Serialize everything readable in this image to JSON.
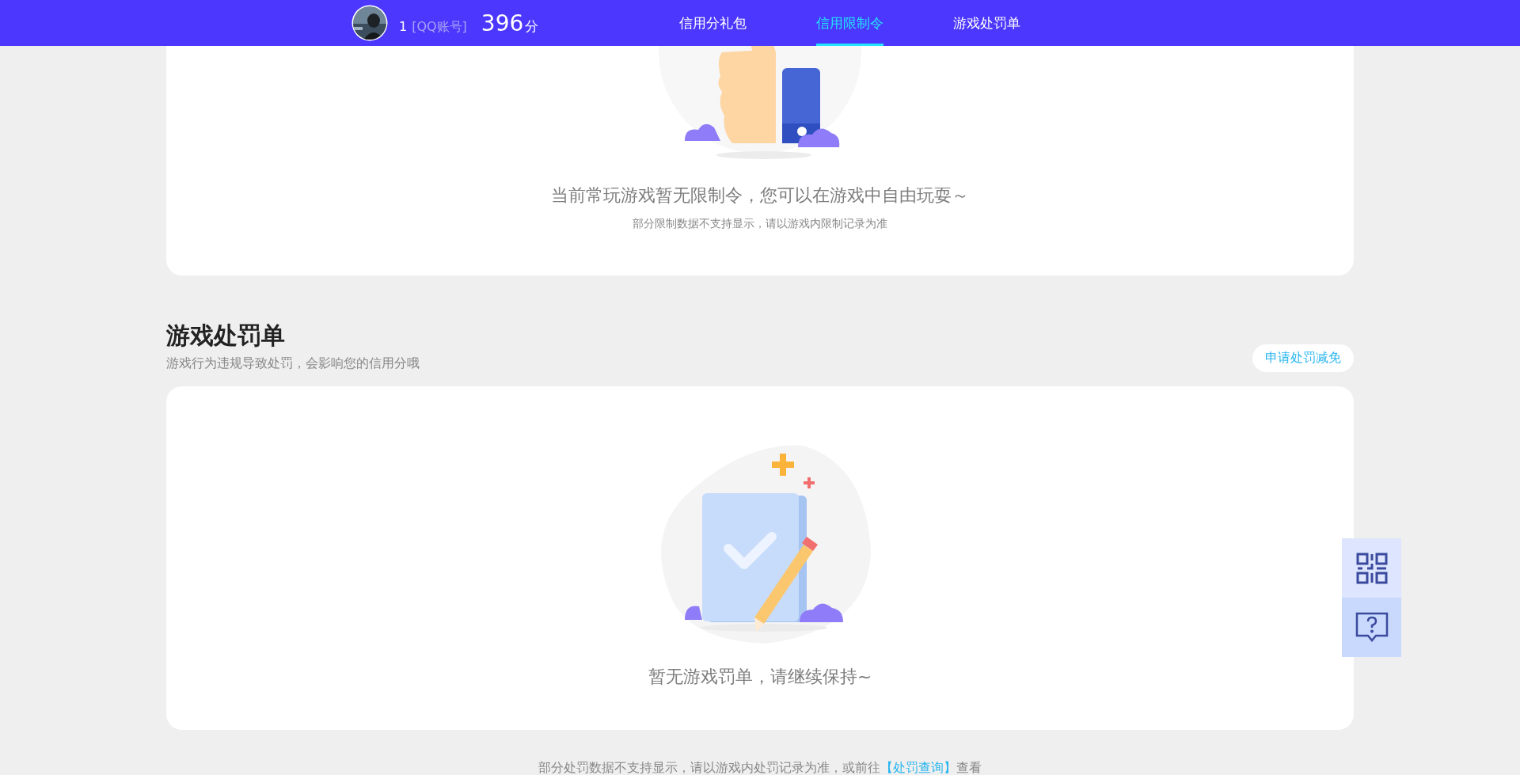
{
  "header": {
    "user_id": "1",
    "account_type": "[QQ账号]",
    "score": "396",
    "score_unit": "分"
  },
  "tabs": [
    {
      "label": "信用分礼包",
      "selected": false
    },
    {
      "label": "信用限制令",
      "selected": true
    },
    {
      "label": "游戏处罚单",
      "selected": false
    }
  ],
  "restriction_card": {
    "message": "当前常玩游戏暂无限制令，您可以在游戏中自由玩耍～",
    "note": "部分限制数据不支持显示，请以游戏内限制记录为准"
  },
  "penalty_section": {
    "title": "游戏处罚单",
    "subtitle": "游戏行为违规导致处罚，会影响您的信用分哦",
    "action": "申请处罚减免",
    "message": "暂无游戏罚单，请继续保持~"
  },
  "footer_note": {
    "before": "部分处罚数据不支持显示，请以游戏内处罚记录为准，或前往",
    "link": "【处罚查询】",
    "after": "查看"
  }
}
